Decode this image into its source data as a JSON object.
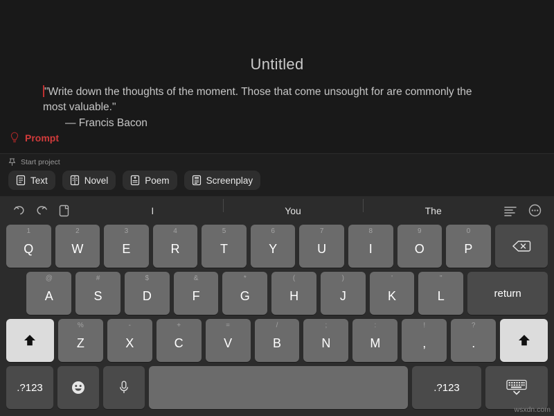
{
  "document": {
    "title": "Untitled",
    "body_line1": "\"Write down the thoughts of the moment. Those that come unsought for are commonly the",
    "body_line2": "most valuable.\"",
    "attribution": "— Francis Bacon",
    "prompt_label": "Prompt",
    "prompt_icon": "lightbulb-icon",
    "caret_color": "#c03030",
    "prompt_color": "#d13b3b"
  },
  "project_bar": {
    "start_label": "Start project",
    "start_icon": "pin-icon",
    "chips": [
      {
        "label": "Text",
        "icon": "document-text-icon"
      },
      {
        "label": "Novel",
        "icon": "book-icon"
      },
      {
        "label": "Poem",
        "icon": "poem-icon"
      },
      {
        "label": "Screenplay",
        "icon": "screenplay-icon"
      }
    ]
  },
  "keyboard": {
    "toolbar": {
      "left_icons": [
        {
          "name": "undo-icon"
        },
        {
          "name": "redo-icon"
        },
        {
          "name": "paste-icon"
        }
      ],
      "predictions": [
        "I",
        "You",
        "The"
      ],
      "right_icons": [
        {
          "name": "text-format-icon"
        },
        {
          "name": "more-options-icon"
        }
      ]
    },
    "row1": [
      {
        "main": "Q",
        "hint": "1"
      },
      {
        "main": "W",
        "hint": "2"
      },
      {
        "main": "E",
        "hint": "3"
      },
      {
        "main": "R",
        "hint": "4"
      },
      {
        "main": "T",
        "hint": "5"
      },
      {
        "main": "Y",
        "hint": "6"
      },
      {
        "main": "U",
        "hint": "7"
      },
      {
        "main": "I",
        "hint": "8"
      },
      {
        "main": "O",
        "hint": "9"
      },
      {
        "main": "P",
        "hint": "0"
      }
    ],
    "delete_key": {
      "icon": "backspace-icon"
    },
    "row2": [
      {
        "main": "A",
        "hint": "@"
      },
      {
        "main": "S",
        "hint": "#"
      },
      {
        "main": "D",
        "hint": "$"
      },
      {
        "main": "F",
        "hint": "&"
      },
      {
        "main": "G",
        "hint": "*"
      },
      {
        "main": "H",
        "hint": "("
      },
      {
        "main": "J",
        "hint": ")"
      },
      {
        "main": "K",
        "hint": "'"
      },
      {
        "main": "L",
        "hint": "\""
      }
    ],
    "return_key": {
      "label": "return"
    },
    "row3": [
      {
        "main": "Z",
        "hint": "%"
      },
      {
        "main": "X",
        "hint": "-"
      },
      {
        "main": "C",
        "hint": "+"
      },
      {
        "main": "V",
        "hint": "="
      },
      {
        "main": "B",
        "hint": "/"
      },
      {
        "main": "N",
        "hint": ";"
      },
      {
        "main": "M",
        "hint": ":"
      },
      {
        "main": ",",
        "hint": "!"
      },
      {
        "main": ".",
        "hint": "?"
      }
    ],
    "shift_left": {
      "icon": "shift-icon",
      "state": "active"
    },
    "shift_right": {
      "icon": "shift-icon",
      "state": "active"
    },
    "row4": {
      "numbers_left": ".?123",
      "emoji": "emoji-icon",
      "mic": "microphone-icon",
      "space": "",
      "numbers_right": ".?123",
      "hide": "hide-keyboard-icon"
    }
  },
  "watermark": "wsxdn.com",
  "colors": {
    "app_bg": "#191919",
    "keyboard_bg": "#2c2c2c",
    "key_bg": "#6b6b6b",
    "key_dark_bg": "#4a4a4a",
    "key_light_bg": "#dcdcdc",
    "accent_red": "#d13b3b"
  }
}
